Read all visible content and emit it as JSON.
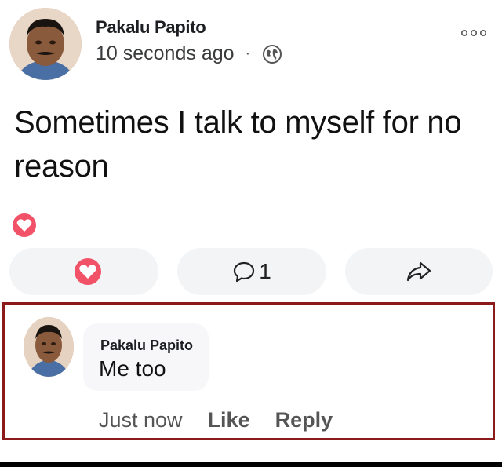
{
  "post": {
    "author": "Pakalu Papito",
    "timestamp": "10 seconds ago",
    "separator": "·",
    "privacy_icon": "globe-icon",
    "text": "Sometimes I talk to myself for no reason",
    "reaction_icon": "heart-icon",
    "actions": {
      "like_icon": "heart-icon",
      "comment_icon": "comment-icon",
      "comment_count": "1",
      "share_icon": "share-icon"
    }
  },
  "comment": {
    "author": "Pakalu Papito",
    "text": "Me too",
    "time": "Just now",
    "like_label": "Like",
    "reply_label": "Reply"
  },
  "colors": {
    "heart": "#f25268",
    "highlight_border": "#8b1a1a",
    "button_bg": "#f3f4f6"
  }
}
